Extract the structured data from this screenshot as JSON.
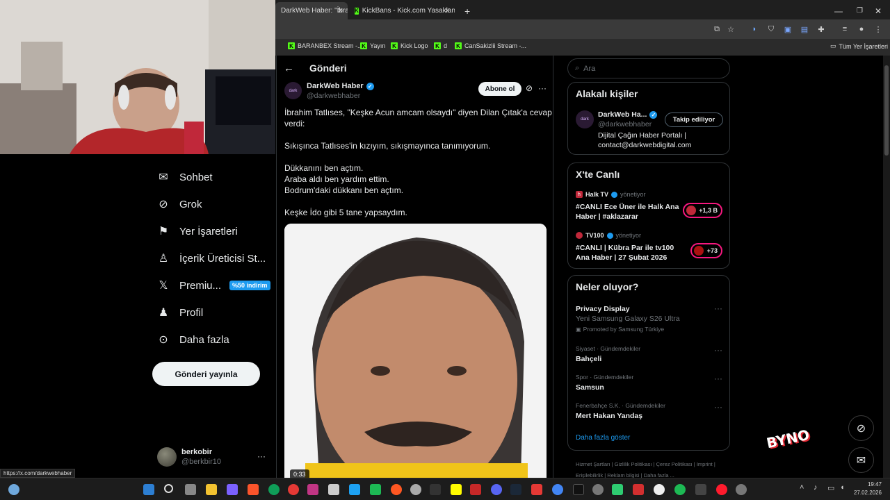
{
  "browser": {
    "tabs": [
      {
        "title": "DarkWeb Haber: \"İbra",
        "active": true
      },
      {
        "title": "KickBans - Kick.com Yasaklanm",
        "active": false
      }
    ],
    "bookmarks": [
      "BARANBEX Stream -...",
      "Yayın",
      "Kick Logo",
      "d",
      "CanSakizlii Stream -..."
    ],
    "bookmarks_folder": "Tüm Yer İşaretleri",
    "status_url": "https://x.com/darkwebhaber"
  },
  "nav": {
    "items": [
      {
        "label": "Sohbet",
        "icon": "mail-icon"
      },
      {
        "label": "Grok",
        "icon": "grok-icon"
      },
      {
        "label": "Yer İşaretleri",
        "icon": "bookmark-icon"
      },
      {
        "label": "İçerik Üreticisi St...",
        "icon": "creator-icon"
      },
      {
        "label": "Premiu...",
        "icon": "x-logo-icon",
        "badge": "%50 indirim"
      },
      {
        "label": "Profil",
        "icon": "person-icon"
      },
      {
        "label": "Daha fazla",
        "icon": "more-circle-icon"
      }
    ],
    "post_button": "Gönderi yayınla",
    "account": {
      "name": "berkobir",
      "handle": "@berkbir10"
    }
  },
  "post": {
    "header_title": "Gönderi",
    "author_name": "DarkWeb Haber",
    "author_handle": "@darkwebhaber",
    "subscribe_label": "Abone ol",
    "lines": [
      "İbrahim Tatlıses, \"Keşke Acun amcam olsaydı\" diyen Dilan Çıtak'a cevap",
      "verdi:",
      "",
      "Sıkışınca Tatlıses'in kızıyım, sıkışmayınca tanımıyorum.",
      "",
      "Dükkanını ben açtım.",
      "Araba aldı ben yardım ettim.",
      "Bodrum'daki dükkanı ben açtım.",
      "",
      "Keşke İdo gibi 5 tane yapsaydım."
    ],
    "video_time": "0:33"
  },
  "sidebar": {
    "search_placeholder": "Ara",
    "related": {
      "title": "Alakalı kişiler",
      "name": "DarkWeb Ha...",
      "handle": "@darkwebhaber",
      "follow_label": "Takip ediliyor",
      "bio_1": "Dijital Çağın Haber Portalı |",
      "bio_2": "contact@darkwebdigital.com"
    },
    "live": {
      "title": "X'te Canlı",
      "items": [
        {
          "channel": "Halk TV",
          "role": "yönetiyor",
          "line1": "#CANLI Ece Üner ile Halk Ana",
          "line2": "Haber | #aklazarar",
          "count": "+1,3 B"
        },
        {
          "channel": "TV100",
          "role": "yönetiyor",
          "line1": "#CANLI | Kübra Par ile tv100",
          "line2": "Ana Haber | 27 Şubat 2026",
          "count": "+73"
        }
      ]
    },
    "trends": {
      "title": "Neler oluyor?",
      "promo": {
        "title": "Privacy Display",
        "subtitle": "Yeni Samsung Galaxy S26 Ultra",
        "promoted": "Promoted by Samsung Türkiye"
      },
      "items": [
        {
          "context": "Siyaset · Gündemdekiler",
          "name": "Bahçeli"
        },
        {
          "context": "Spor · Gündemdekiler",
          "name": "Samsun"
        },
        {
          "context": "Fenerbahçe S.K. · Gündemdekiler",
          "name": "Mert Hakan Yandaş"
        }
      ],
      "show_more": "Daha fazla göster"
    },
    "footer": [
      "Hizmet Şartları",
      "Gizlilik Politikası",
      "Çerez Politikası",
      "Imprint",
      "Erişilebilirlik",
      "Reklam bilgisi",
      "Daha fazla ..."
    ]
  },
  "overlay_logo": "BYNO",
  "taskbar": {
    "time": "19:47",
    "date": "27.02.2026"
  },
  "colors": {
    "verified": "#1d9bf0",
    "link": "#1d9bf0",
    "live_border": "#f91880",
    "premium_badge": "#1d9bf0"
  }
}
